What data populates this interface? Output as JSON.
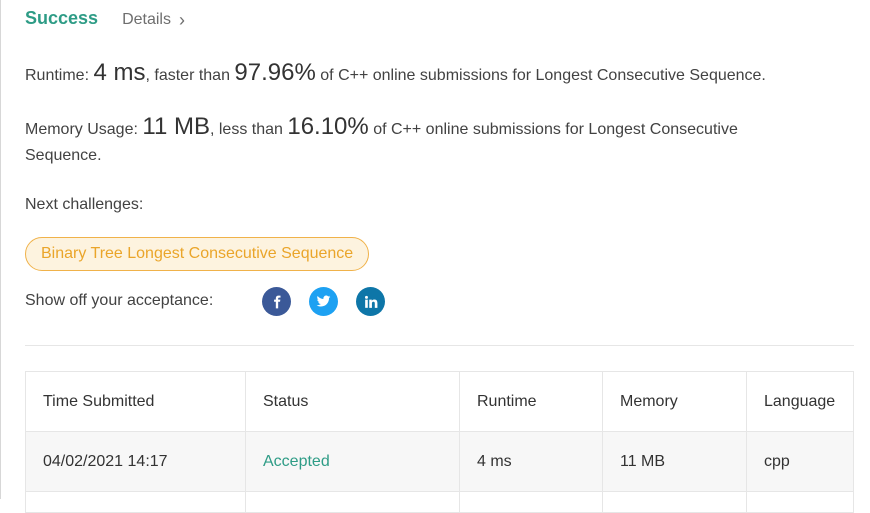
{
  "header": {
    "success_label": "Success",
    "details_label": "Details",
    "chevron": "›"
  },
  "runtime": {
    "label": "Runtime: ",
    "value": "4 ms",
    "mid": ", faster than ",
    "percent": "97.96%",
    "suffix": " of C++ online submissions for Longest Consecutive Sequence."
  },
  "memory": {
    "label": "Memory Usage: ",
    "value": "11 MB",
    "mid": ", less than ",
    "percent": "16.10%",
    "suffix": " of C++ online submissions for Longest Consecutive",
    "suffix_line2": "Sequence."
  },
  "next": {
    "label": "Next challenges:",
    "challenges": [
      "Binary Tree Longest Consecutive Sequence"
    ]
  },
  "share": {
    "label": "Show off your acceptance:",
    "icons": [
      "facebook-icon",
      "twitter-icon",
      "linkedin-icon"
    ]
  },
  "table": {
    "headers": [
      "Time Submitted",
      "Status",
      "Runtime",
      "Memory",
      "Language"
    ],
    "rows": [
      {
        "time": "04/02/2021 14:17",
        "status": "Accepted",
        "runtime": "4 ms",
        "memory": "11 MB",
        "language": "cpp"
      }
    ]
  },
  "colors": {
    "accent": "#2e9c86",
    "chip": "#eaa52a",
    "facebook": "#3b5998",
    "twitter": "#1da1f2",
    "linkedin": "#0e76a8"
  }
}
